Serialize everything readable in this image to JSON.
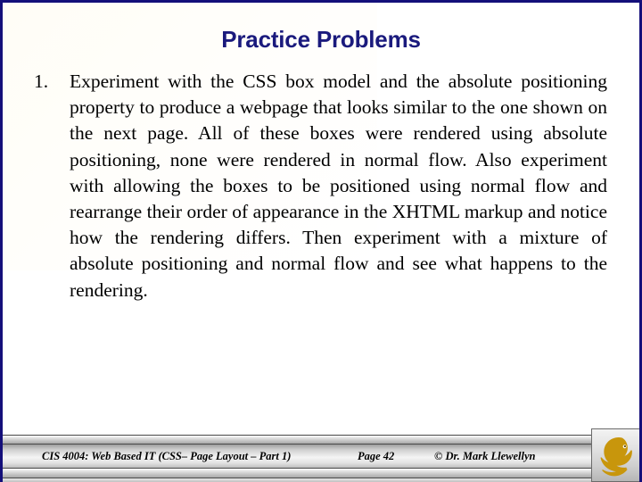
{
  "slide": {
    "title": "Practice Problems",
    "title_color": "#1a1a7d",
    "border_color": "#140f7a",
    "background_color": "#ffffff"
  },
  "body": {
    "items": [
      {
        "marker": "1.",
        "text": "Experiment with the CSS box model and the absolute positioning property to produce a webpage that looks similar to the one shown on the next page. All of these boxes were rendered using absolute positioning, none were rendered in normal flow.  Also experiment with allowing the boxes to be positioned using normal flow and rearrange their order of appearance in the XHTML markup and notice how the rendering differs.  Then experiment with a mixture of absolute positioning and normal flow and see what happens to the rendering."
      }
    ]
  },
  "footer": {
    "course": "CIS 4004: Web Based IT (CSS– Page Layout – Part 1)",
    "page": "Page 42",
    "copyright": "© Dr. Mark Llewellyn",
    "logo_name": "ucf-pegasus-logo",
    "logo_color": "#c8960c"
  }
}
